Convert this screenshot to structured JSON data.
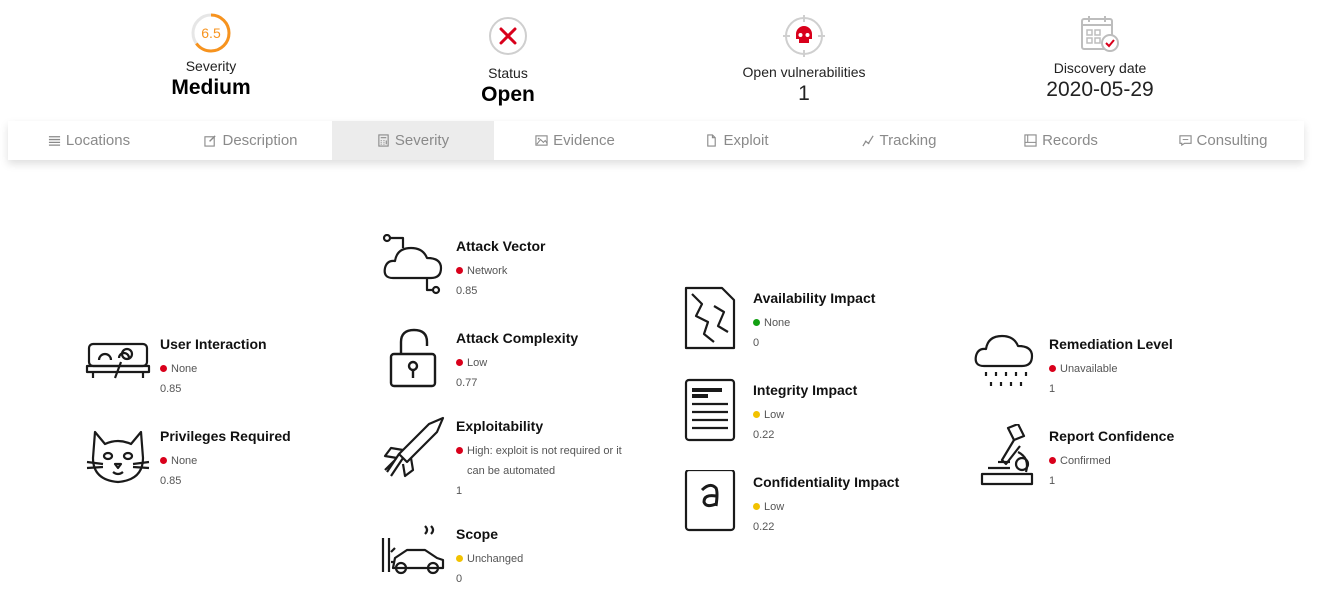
{
  "header": {
    "severity": {
      "score": "6.5",
      "label": "Severity",
      "value": "Medium",
      "accent": "#f7931e"
    },
    "status": {
      "label": "Status",
      "value": "Open",
      "accent": "#d9001b"
    },
    "open_vulnerabilities": {
      "label": "Open vulnerabilities",
      "value": "1"
    },
    "discovery_date": {
      "label": "Discovery date",
      "value": "2020-05-29"
    }
  },
  "tabs": [
    {
      "label": "Locations",
      "icon": "list-icon"
    },
    {
      "label": "Description",
      "icon": "edit-icon"
    },
    {
      "label": "Severity",
      "icon": "calculator-icon",
      "active": true
    },
    {
      "label": "Evidence",
      "icon": "image-icon"
    },
    {
      "label": "Exploit",
      "icon": "file-icon"
    },
    {
      "label": "Tracking",
      "icon": "line-chart-icon"
    },
    {
      "label": "Records",
      "icon": "table-icon"
    },
    {
      "label": "Consulting",
      "icon": "comment-icon"
    }
  ],
  "metrics": {
    "user_interaction": {
      "title": "User Interaction",
      "level": "None",
      "score": "0.85",
      "color": "red",
      "icon": "sofa-icon"
    },
    "privileges_required": {
      "title": "Privileges Required",
      "level": "None",
      "score": "0.85",
      "color": "red",
      "icon": "cat-icon"
    },
    "attack_vector": {
      "title": "Attack Vector",
      "level": "Network",
      "score": "0.85",
      "color": "red",
      "icon": "cloud-network-icon"
    },
    "attack_complexity": {
      "title": "Attack Complexity",
      "level": "Low",
      "score": "0.77",
      "color": "red",
      "icon": "padlock-icon"
    },
    "exploitability": {
      "title": "Exploitability",
      "level": "High: exploit is not required or it can be automated",
      "score": "1",
      "color": "red",
      "icon": "rocket-icon"
    },
    "scope": {
      "title": "Scope",
      "level": "Unchanged",
      "score": "0",
      "color": "yellow",
      "icon": "car-crash-icon"
    },
    "availability_impact": {
      "title": "Availability Impact",
      "level": "None",
      "score": "0",
      "color": "green",
      "icon": "broken-page-icon"
    },
    "integrity_impact": {
      "title": "Integrity Impact",
      "level": "Low",
      "score": "0.22",
      "color": "yellow",
      "icon": "document-icon"
    },
    "confidentiality_impact": {
      "title": "Confidentiality Impact",
      "level": "Low",
      "score": "0.22",
      "color": "yellow",
      "icon": "letter-card-icon"
    },
    "remediation_level": {
      "title": "Remediation Level",
      "level": "Unavailable",
      "score": "1",
      "color": "red",
      "icon": "rain-cloud-icon"
    },
    "report_confidence": {
      "title": "Report Confidence",
      "level": "Confirmed",
      "score": "1",
      "color": "red",
      "icon": "microscope-icon"
    }
  }
}
